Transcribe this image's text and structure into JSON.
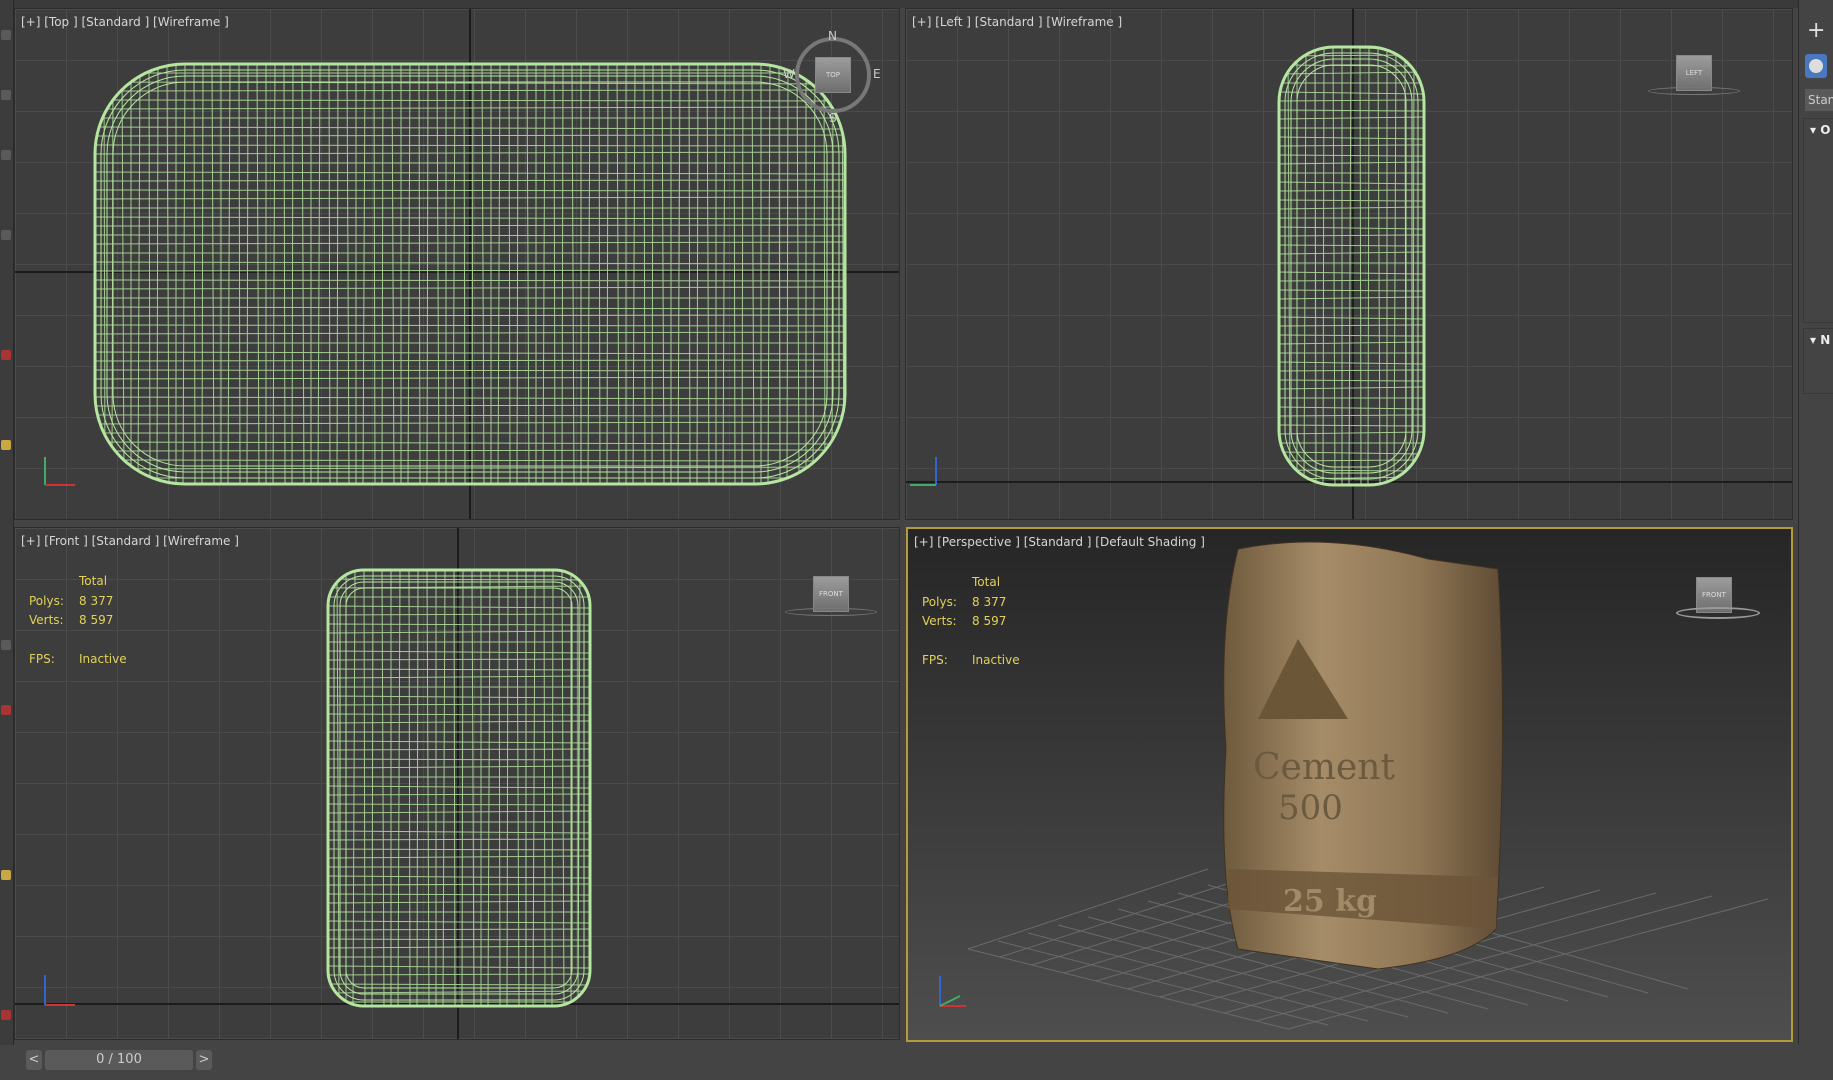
{
  "viewports": {
    "top": {
      "label": "[+] [Top ] [Standard ] [Wireframe ]",
      "cube": "TOP",
      "compass": {
        "n": "N",
        "s": "S",
        "e": "E",
        "w": "W"
      }
    },
    "left": {
      "label": "[+] [Left ] [Standard ] [Wireframe ]",
      "cube": "LEFT"
    },
    "front": {
      "label": "[+] [Front ] [Standard ] [Wireframe ]",
      "cube": "FRONT",
      "stats": {
        "header": "Total",
        "polys_label": "Polys:",
        "polys": "8 377",
        "verts_label": "Verts:",
        "verts": "8 597",
        "fps_label": "FPS:",
        "fps": "Inactive"
      }
    },
    "perspective": {
      "label": "[+] [Perspective ] [Standard ] [Default Shading ]",
      "cube": "FRONT",
      "stats": {
        "header": "Total",
        "polys_label": "Polys:",
        "polys": "8 377",
        "verts_label": "Verts:",
        "verts": "8 597",
        "fps_label": "FPS:",
        "fps": "Inactive"
      },
      "texture_text": {
        "line1": "Cement",
        "line2": "500",
        "line3": "25 kg"
      }
    }
  },
  "wire_color": "#b5e6a0",
  "active_border": "#b39a3b",
  "stats_color": "#e2d25a",
  "right_panel": {
    "dropdown": "Stan",
    "rollout1": "O",
    "rollout2": "N"
  },
  "timeline": {
    "prev": "<",
    "next": ">",
    "frame": "0 / 100"
  }
}
